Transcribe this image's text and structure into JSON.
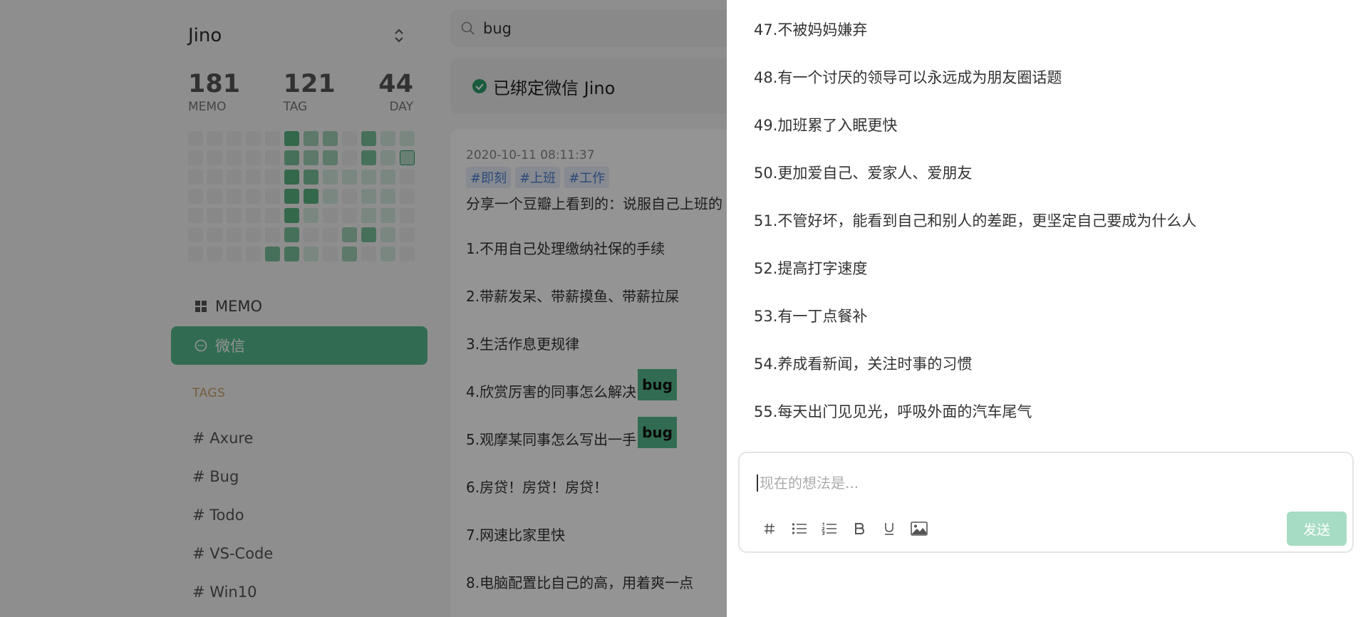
{
  "colors": {
    "accent": "#55bb8e",
    "tags_title": "#c9a36a",
    "tag_blue": "#4a7fd4",
    "send_disabled": "#a6dcc3",
    "overlay": "rgba(0,0,0,0.42)"
  },
  "sidebar": {
    "user_name": "Jino",
    "switch_icon": "chevron-up-down-icon",
    "stats": [
      {
        "value": "181",
        "label": "MEMO"
      },
      {
        "value": "121",
        "label": "TAG"
      },
      {
        "value": "44",
        "label": "DAY"
      }
    ],
    "heatmap": {
      "columns": 12,
      "rows": 7,
      "levels": [
        [
          0,
          0,
          0,
          0,
          0,
          4,
          2,
          2,
          0,
          3,
          1,
          1
        ],
        [
          0,
          0,
          0,
          0,
          0,
          3,
          2,
          2,
          0,
          3,
          1,
          "t"
        ],
        [
          0,
          0,
          0,
          0,
          0,
          4,
          3,
          1,
          1,
          1,
          1,
          0
        ],
        [
          0,
          0,
          0,
          0,
          0,
          4,
          4,
          1,
          0,
          1,
          1,
          0
        ],
        [
          0,
          0,
          0,
          0,
          0,
          4,
          1,
          0,
          0,
          1,
          1,
          0
        ],
        [
          0,
          0,
          0,
          0,
          0,
          3,
          0,
          0,
          2,
          3,
          1,
          0
        ],
        [
          0,
          0,
          0,
          0,
          3,
          3,
          1,
          0,
          2,
          0,
          1,
          0
        ]
      ]
    },
    "nav": [
      {
        "label": "MEMO",
        "icon": "grid-icon",
        "active": false
      },
      {
        "label": "微信",
        "icon": "chat-bubble-icon",
        "active": true
      }
    ],
    "tags_title": "TAGS",
    "tags": [
      "# Axure",
      "# Bug",
      "# Todo",
      "# VS-Code",
      "# Win10"
    ]
  },
  "search": {
    "icon": "search-icon",
    "value": "bug"
  },
  "bind_banner": {
    "icon": "check-circle-icon",
    "text": "已绑定微信 Jino"
  },
  "memo": {
    "time": "2020-10-11 08:11:37",
    "tags": [
      "#即刻",
      "#上班",
      "#工作"
    ],
    "lines": [
      {
        "text": "分享一个豆瓣上看到的：说服自己上班的",
        "highlight": ""
      },
      {
        "text": "1.不用自己处理缴纳社保的手续",
        "highlight": ""
      },
      {
        "text": "2.带薪发呆、带薪摸鱼、带薪拉屎",
        "highlight": ""
      },
      {
        "text": "3.生活作息更规律",
        "highlight": ""
      },
      {
        "text": "4.欣赏厉害的同事怎么解决",
        "highlight": "bug"
      },
      {
        "text": "5.观摩某同事怎么写出一手",
        "highlight": "bug"
      },
      {
        "text": "6.房贷！房贷！房贷！",
        "highlight": ""
      },
      {
        "text": "7.网速比家里快",
        "highlight": ""
      },
      {
        "text": "8.电脑配置比自己的高，用着爽一点",
        "highlight": ""
      }
    ]
  },
  "panel": {
    "lines": [
      "47.不被妈妈嫌弃",
      "48.有一个讨厌的领导可以永远成为朋友圈话题",
      "49.加班累了入眠更快",
      "50.更加爱自己、爱家人、爱朋友",
      "51.不管好坏，能看到自己和别人的差距，更坚定自己要成为什么人",
      "52.提高打字速度",
      "53.有一丁点餐补",
      "54.养成看新闻，关注时事的习惯",
      "55.每天出门见见光，呼吸外面的汽车尾气"
    ],
    "editor": {
      "placeholder": "现在的想法是...",
      "value": "",
      "tools": [
        {
          "name": "hash-tag-icon"
        },
        {
          "name": "bullet-list-icon"
        },
        {
          "name": "numbered-list-icon"
        },
        {
          "name": "bold-icon"
        },
        {
          "name": "underline-icon"
        },
        {
          "name": "image-icon"
        }
      ],
      "send_label": "发送"
    }
  }
}
